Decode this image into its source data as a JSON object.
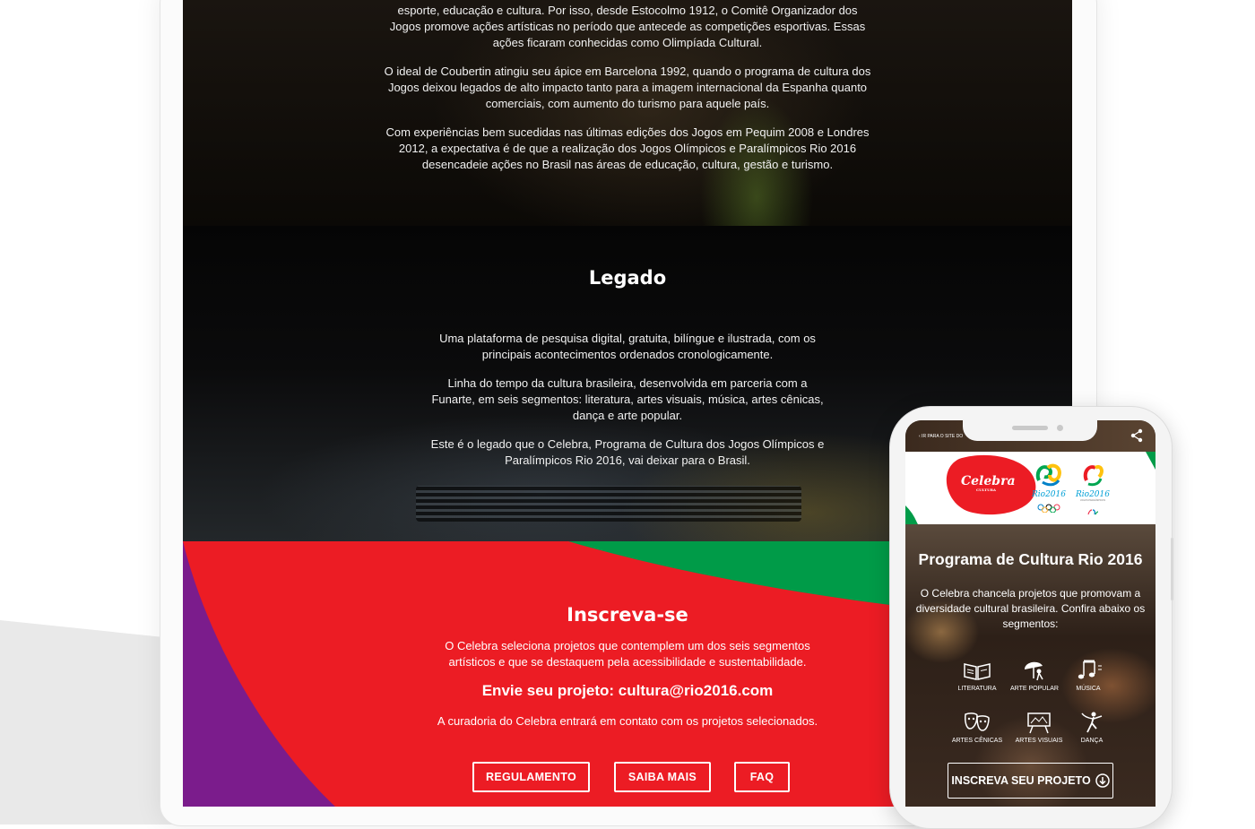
{
  "intro": {
    "paragraphs": [
      "esporte, educação e cultura. Por isso, desde Estocolmo 1912, o Comitê Organizador dos Jogos promove ações artísticas no período que antecede as competições esportivas. Essas ações ficaram conhecidas como Olimpíada Cultural.",
      "O ideal de Coubertin atingiu seu ápice em Barcelona 1992, quando o programa de cultura dos Jogos deixou legados de alto impacto tanto para a imagem internacional da Espanha quanto comerciais, com aumento do turismo para aquele país.",
      "Com experiências bem sucedidas nas últimas edições dos Jogos em Pequim 2008 e Londres 2012, a expectativa é de que a realização dos Jogos Olímpicos e Paralímpicos Rio 2016 desencadeie ações no Brasil nas áreas de educação, cultura, gestão e turismo."
    ]
  },
  "legado": {
    "title": "Legado",
    "paragraphs": [
      "Uma plataforma de pesquisa digital, gratuita, bilíngue e ilustrada, com os principais acontecimentos ordenados cronologicamente.",
      "Linha do tempo da cultura brasileira, desenvolvida em parceria com a Funarte, em seis segmentos: literatura, artes visuais, música, artes cênicas, dança e arte popular.",
      "Este é o legado que o Celebra, Programa de Cultura dos Jogos Olímpicos e Paralímpicos Rio 2016, vai deixar para o Brasil."
    ]
  },
  "inscreva": {
    "title": "Inscreva-se",
    "description": "O Celebra seleciona projetos que contemplem um dos seis segmentos artísticos e que se destaquem pela acessibilidade e sustentabilidade.",
    "email_line": "Envie seu projeto: cultura@rio2016.com",
    "note": "A curadoria do Celebra entrará em contato com os projetos selecionados.",
    "buttons": [
      "REGULAMENTO",
      "SAIBA MAIS",
      "FAQ"
    ]
  },
  "phone": {
    "back_link": "‹ IR PARA O SITE DO",
    "logo": {
      "celebra": "Celebra",
      "celebra_sub": "CULTURA",
      "rio1": "Rio2016",
      "rio2": "Rio2016",
      "rio2_sub": "JOGOS PARALÍMPICOS"
    },
    "title": "Programa de Cultura Rio 2016",
    "description": "O Celebra chancela projetos que promovam a diversidade cultural brasileira. Confira abaixo os segmentos:",
    "segments": [
      "LITERATURA",
      "ARTE POPULAR",
      "MÚSICA",
      "ARTES CÊNICAS",
      "ARTES VISUAIS",
      "DANÇA"
    ],
    "cta": "INSCREVA SEU PROJETO"
  },
  "colors": {
    "red": "#ec1c24",
    "green": "#009b48",
    "purple": "#7b1c8c",
    "white": "#ffffff"
  },
  "icons": [
    "share-icon",
    "book-icon",
    "umbrella-dancer-icon",
    "music-notes-icon",
    "theater-masks-icon",
    "easel-icon",
    "dancer-icon",
    "arrow-down-circle-icon"
  ]
}
